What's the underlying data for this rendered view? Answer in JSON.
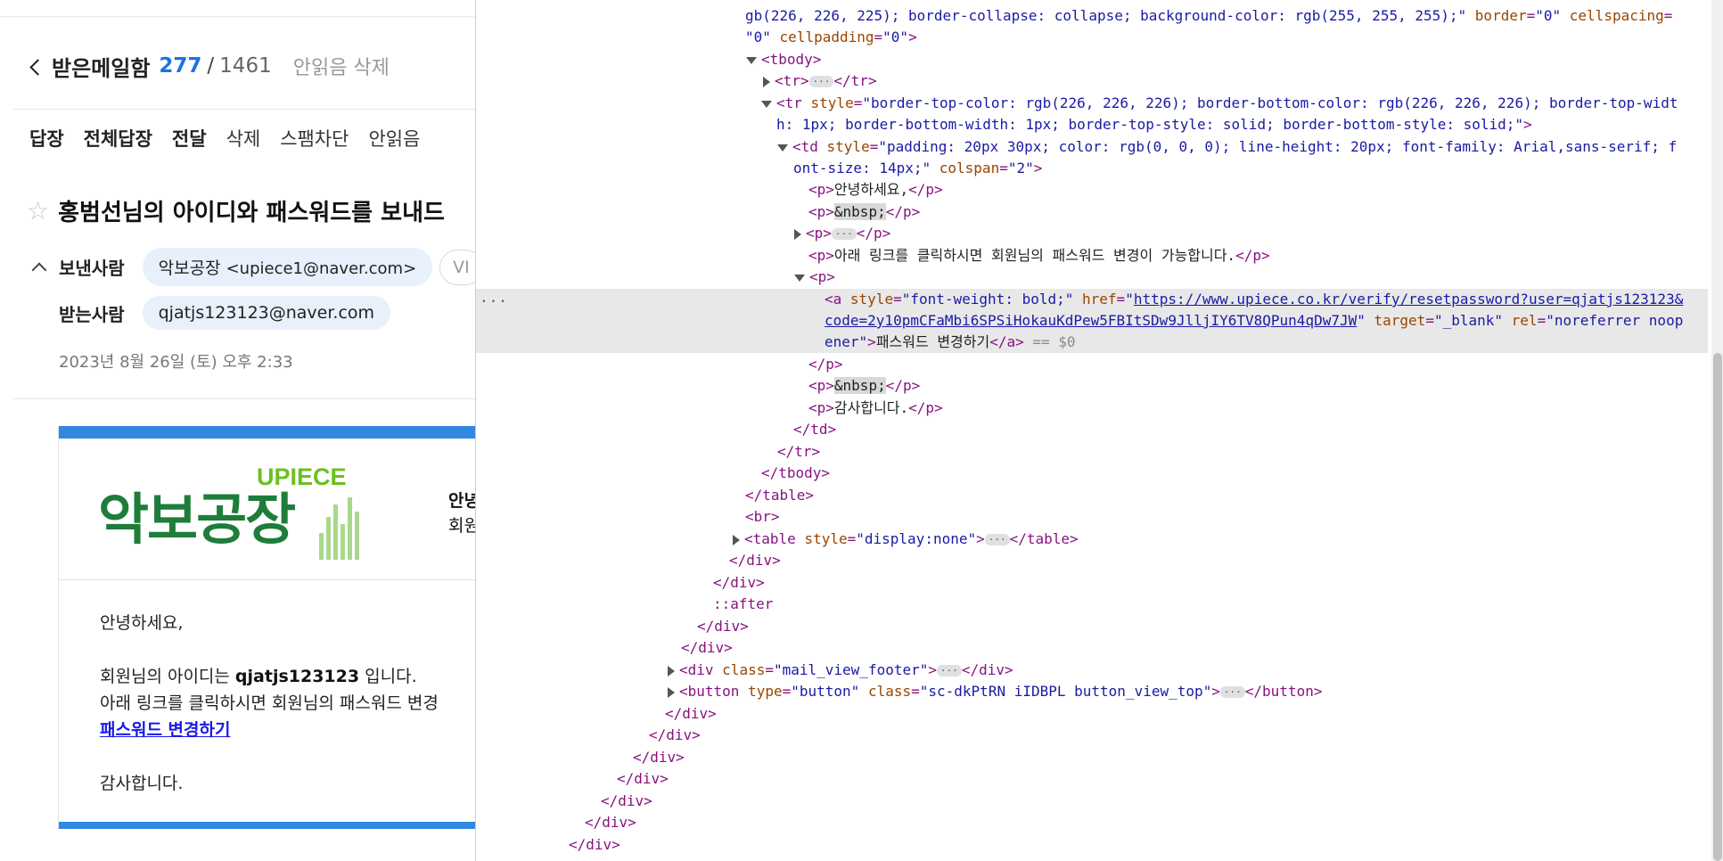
{
  "mail": {
    "folder_title": "받은메일함",
    "unread_count": "277",
    "slash": "/",
    "total_count": "1461",
    "delete_unread": "안읽음 삭제",
    "toolbar": [
      "답장",
      "전체답장",
      "전달",
      "삭제",
      "스팸차단",
      "안읽음"
    ],
    "subject": "홍범선님의 아이디와 패스워드를 보내드",
    "sender_label": "보낸사람",
    "sender_name": "악보공장",
    "sender_email": "<upiece1@naver.com>",
    "sender_vip": "VI",
    "recipient_label": "받는사람",
    "recipient_email": "qjatjs123123@naver.com",
    "date": "2023년 8월 26일 (토) 오후 2:33",
    "logo_top": "UPIECE",
    "logo_main": "악보공장",
    "greet_side_1": "안녕",
    "greet_side_2": "회원",
    "body_hello": "안녕하세요,",
    "body_id_prefix": "회원님의 아이디는 ",
    "body_id": "qjatjs123123",
    "body_id_suffix": " 입니다.",
    "body_link_line": "아래 링크를 클릭하시면 회원님의 패스워드 변경",
    "body_link": "패스워드 변경하기",
    "body_thanks": "감사합니다."
  },
  "devtools": {
    "l0a": "gb(226, 226, 225); border-collapse: collapse; background-color: rgb(255, 255, 255);\"",
    "l0b": "border",
    "l0c": "\"0\"",
    "l0d": "cellspacing",
    "l0e": "\"0\"",
    "l0f": "cellpadding",
    "l0g": "\"0\"",
    "tbody_open": "<tbody>",
    "tr_collapsed": "<tr>",
    "tr_close": "</tr>",
    "tr_style_attr": "style",
    "tr_style_val_1": "\"border-top-color: rgb(226, 226, 226); border-bottom-color: rgb(226, 226, 226); border-top-widt",
    "tr_style_val_2": "h: 1px; border-bottom-width: 1px; border-top-style: solid; border-bottom-style: solid;\"",
    "td_style_val_1": "\"padding: 20px 30px; color: rgb(0, 0, 0); line-height: 20px; font-family: Arial,sans-serif; f",
    "td_style_val_2": "ont-size: 14px;\"",
    "colspan_val": "\"2\"",
    "p_hello": "안녕하세요,",
    "nbsp": "&nbsp;",
    "p_link_line": "아래 링크를 클릭하시면 회원님의 패스워드 변경이 가능합니다.",
    "a_style_val": "\"font-weight: bold;\"",
    "a_href_1": "https://www.upiece.co.kr/verify/resetpassword?user=qjatjs123123&",
    "a_href_2": "code=2y10pmCFaMbi6SPSiHokauKdPew5FBItSDw9JlljIY6TV8QPun4qDw7JW",
    "a_target_val": "\"_blank\"",
    "a_rel_val_1": "\"noreferrer noop",
    "a_rel_val_2": "ener\"",
    "a_text": "패스워드 변경하기",
    "dollar0": "== $0",
    "p_thanks": "감사합니다.",
    "table_style_val": "\"display:none\"",
    "after": "::after",
    "footer_class_val": "\"mail_view_footer\"",
    "button_type_val": "\"button\"",
    "button_class_val": "\"sc-dkPtRN iIDBPL button_view_top\"",
    "sel_dots": "..."
  }
}
